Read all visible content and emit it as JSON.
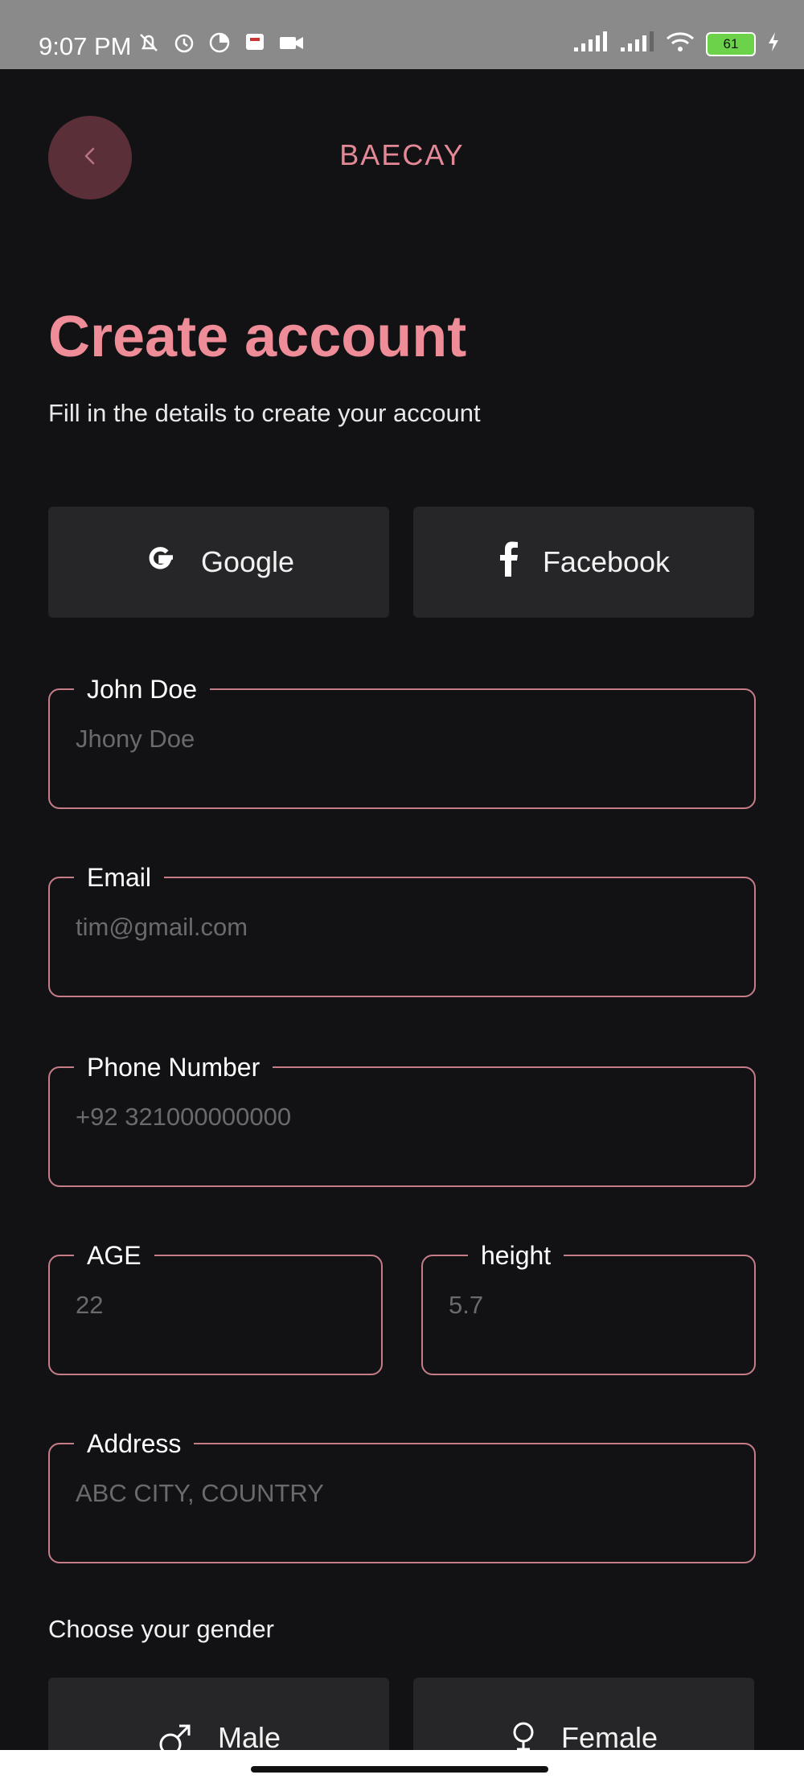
{
  "status_bar": {
    "time": "9:07 PM",
    "battery": "61",
    "icons_left": [
      "mute-alarm-icon",
      "alarm-icon",
      "data-saver-icon",
      "notification-icon",
      "video-icon"
    ],
    "icons_right": [
      "signal-icon",
      "signal-icon",
      "wifi-icon",
      "battery-icon",
      "charging-icon"
    ]
  },
  "header": {
    "app_title": "BAECAY",
    "back_icon": "chevron-left-icon"
  },
  "page": {
    "title": "Create account",
    "subtitle": "Fill in the details to create your account"
  },
  "social": {
    "google_label": "Google",
    "facebook_label": "Facebook"
  },
  "form": {
    "name": {
      "label": "John Doe",
      "placeholder": "Jhony Doe"
    },
    "email": {
      "label": "Email",
      "placeholder": "tim@gmail.com"
    },
    "phone": {
      "label": "Phone Number",
      "placeholder": "+92 321000000000"
    },
    "age": {
      "label": "AGE",
      "placeholder": "22"
    },
    "height": {
      "label": "height",
      "placeholder": "5.7"
    },
    "address": {
      "label": "Address",
      "placeholder": "ABC CITY, COUNTRY"
    }
  },
  "gender": {
    "label": "Choose your gender",
    "male_label": "Male",
    "female_label": "Female"
  },
  "colors": {
    "accent": "#ee8c98",
    "background": "#121215",
    "button_bg": "#262628",
    "field_border": "#c67d88"
  }
}
